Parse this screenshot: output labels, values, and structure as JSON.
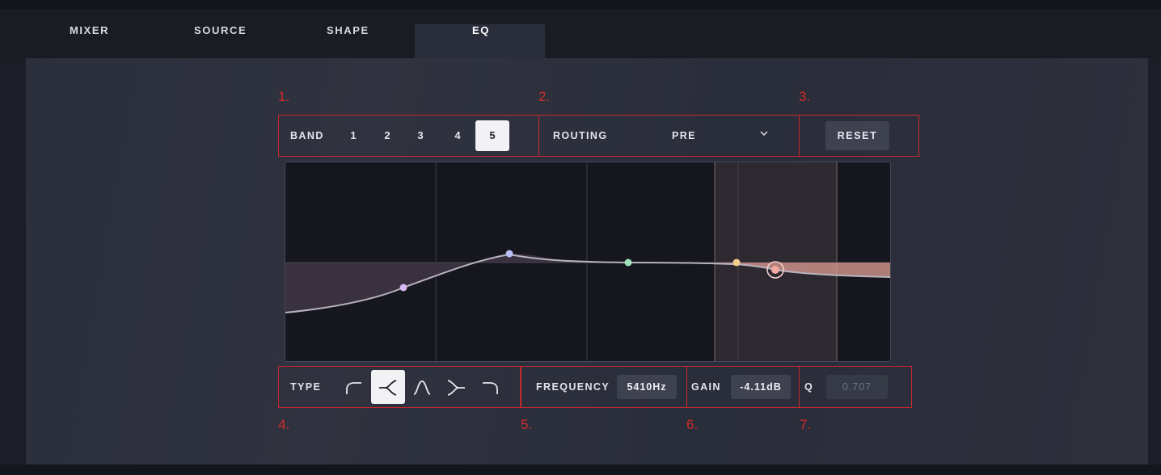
{
  "tabs": [
    {
      "label": "MIXER"
    },
    {
      "label": "SOURCE"
    },
    {
      "label": "SHAPE"
    },
    {
      "label": "EQ",
      "active": true
    }
  ],
  "annotations": [
    "1.",
    "2.",
    "3.",
    "4.",
    "5.",
    "6.",
    "7."
  ],
  "band": {
    "label": "BAND",
    "options": [
      "1",
      "2",
      "3",
      "4",
      "5"
    ],
    "selected": "5"
  },
  "routing": {
    "label": "ROUTING",
    "value": "PRE",
    "icon": "chevron-down-icon"
  },
  "reset_label": "RESET",
  "type": {
    "label": "TYPE",
    "icons": [
      "low-cut-icon",
      "low-shelf-icon",
      "bell-icon",
      "high-shelf-icon",
      "high-cut-icon"
    ],
    "selected_index": 1
  },
  "frequency": {
    "label": "FREQUENCY",
    "value": "5410Hz"
  },
  "gain": {
    "label": "GAIN",
    "value": "-4.11dB"
  },
  "q": {
    "label": "Q",
    "value": "0.707"
  },
  "colors": {
    "accent_red": "#c8282c",
    "node_band1": "#d9b8f0",
    "node_band2": "#b8c0f5",
    "node_band3": "#9fe0bd",
    "node_band4": "#f2cf8c",
    "node_band5": "#f4a8a0"
  }
}
